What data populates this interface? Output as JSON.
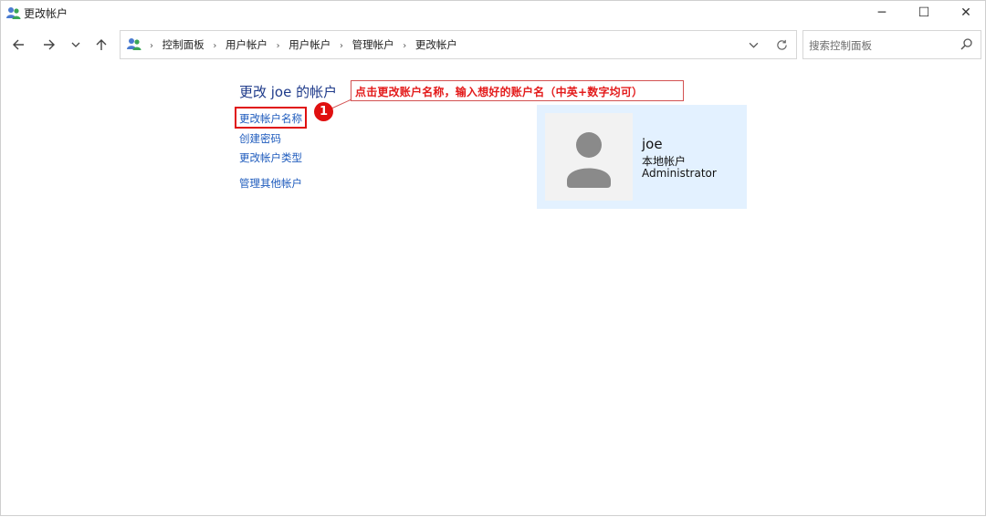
{
  "window": {
    "title": "更改帐户",
    "controls": {
      "minimize": "─",
      "maximize": "☐",
      "close": "✕"
    }
  },
  "nav": {
    "back_icon": "arrow-left-icon",
    "forward_icon": "arrow-right-icon",
    "recent_icon": "chevron-down-icon",
    "up_icon": "arrow-up-icon",
    "breadcrumbs": [
      "控制面板",
      "用户帐户",
      "用户帐户",
      "管理帐户",
      "更改帐户"
    ],
    "search_placeholder": "搜索控制面板"
  },
  "main": {
    "heading": "更改 joe 的帐户",
    "links": [
      "更改帐户名称",
      "创建密码",
      "更改帐户类型",
      "管理其他帐户"
    ]
  },
  "annotation": {
    "callout_text": "点击更改账户名称，输入想好的账户名（中英+数字均可）",
    "badge_number": "1",
    "highlight_color": "#e01010"
  },
  "account": {
    "name": "joe",
    "type": "本地帐户",
    "role": "Administrator",
    "card_color": "#e3f1ff"
  }
}
